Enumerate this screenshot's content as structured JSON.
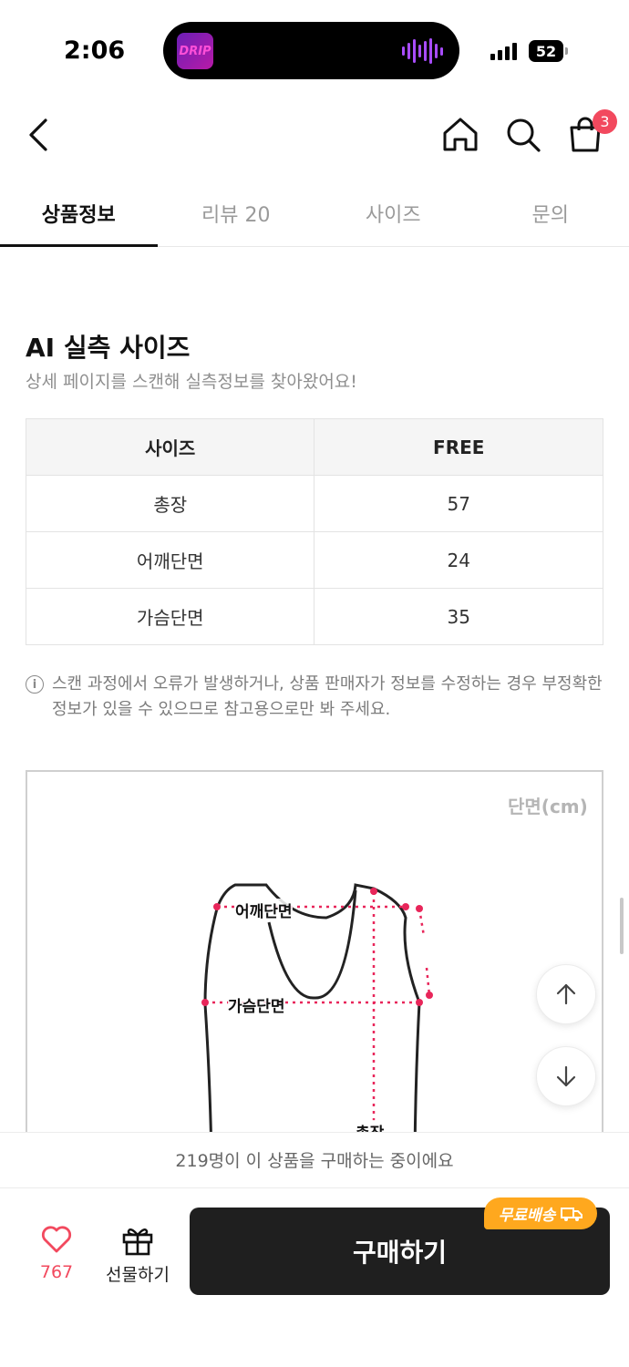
{
  "status_bar": {
    "time": "2:06",
    "app_badge_text": "DRIP",
    "battery": "52",
    "icons": [
      "drip-app-icon",
      "waveform-icon",
      "signal-icon",
      "battery-icon"
    ]
  },
  "header": {
    "icons": [
      "back-icon",
      "home-icon",
      "search-icon",
      "shopping-bag-icon"
    ],
    "cart_count": "3"
  },
  "tabs": [
    {
      "label": "상품정보",
      "active": true
    },
    {
      "label": "리뷰 20",
      "active": false
    },
    {
      "label": "사이즈",
      "active": false
    },
    {
      "label": "문의",
      "active": false
    }
  ],
  "ai_size": {
    "title": "AI 실측 사이즈",
    "subtitle": "상세 페이지를 스캔해 실측정보를 찾아왔어요!",
    "table": {
      "headers": [
        "사이즈",
        "FREE"
      ],
      "rows": [
        [
          "총장",
          "57"
        ],
        [
          "어깨단면",
          "24"
        ],
        [
          "가슴단면",
          "35"
        ]
      ]
    },
    "notice": "스캔 과정에서 오류가 발생하거나, 상품 판매자가 정보를 수정하는 경우 부정확한 정보가 있을 수 있으므로 참고용으로만 봐 주세요."
  },
  "diagram": {
    "unit_label": "단면(cm)",
    "labels": {
      "shoulder": "어깨단면",
      "chest": "가슴단면",
      "length": "총장"
    },
    "accent_color": "#e8265a"
  },
  "buying_info": "219명이 이 상품을 구매하는 중이에요",
  "bottom_bar": {
    "like_count": "767",
    "gift_label": "선물하기",
    "buy_label": "구매하기",
    "free_shipping_label": "무료배송",
    "colors": {
      "buy_button": "#1f1f1f",
      "badge": "#ffa81e",
      "heart": "#f2495e"
    }
  }
}
